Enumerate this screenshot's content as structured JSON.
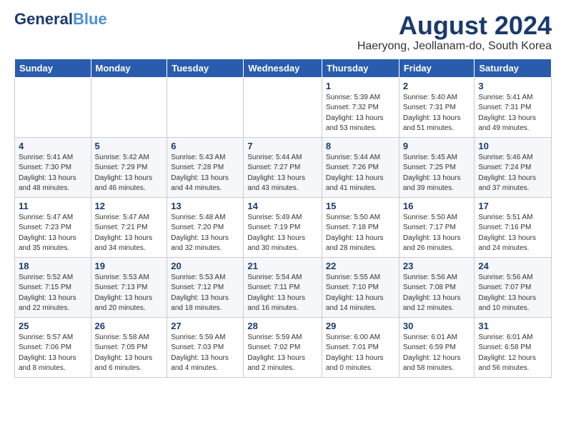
{
  "logo": {
    "line1": "General",
    "line1_accent": "Blue",
    "tagline": ""
  },
  "title": "August 2024",
  "location": "Haeryong, Jeollanam-do, South Korea",
  "weekdays": [
    "Sunday",
    "Monday",
    "Tuesday",
    "Wednesday",
    "Thursday",
    "Friday",
    "Saturday"
  ],
  "weeks": [
    [
      {
        "day": "",
        "info": ""
      },
      {
        "day": "",
        "info": ""
      },
      {
        "day": "",
        "info": ""
      },
      {
        "day": "",
        "info": ""
      },
      {
        "day": "1",
        "info": "Sunrise: 5:39 AM\nSunset: 7:32 PM\nDaylight: 13 hours\nand 53 minutes."
      },
      {
        "day": "2",
        "info": "Sunrise: 5:40 AM\nSunset: 7:31 PM\nDaylight: 13 hours\nand 51 minutes."
      },
      {
        "day": "3",
        "info": "Sunrise: 5:41 AM\nSunset: 7:31 PM\nDaylight: 13 hours\nand 49 minutes."
      }
    ],
    [
      {
        "day": "4",
        "info": "Sunrise: 5:41 AM\nSunset: 7:30 PM\nDaylight: 13 hours\nand 48 minutes."
      },
      {
        "day": "5",
        "info": "Sunrise: 5:42 AM\nSunset: 7:29 PM\nDaylight: 13 hours\nand 46 minutes."
      },
      {
        "day": "6",
        "info": "Sunrise: 5:43 AM\nSunset: 7:28 PM\nDaylight: 13 hours\nand 44 minutes."
      },
      {
        "day": "7",
        "info": "Sunrise: 5:44 AM\nSunset: 7:27 PM\nDaylight: 13 hours\nand 43 minutes."
      },
      {
        "day": "8",
        "info": "Sunrise: 5:44 AM\nSunset: 7:26 PM\nDaylight: 13 hours\nand 41 minutes."
      },
      {
        "day": "9",
        "info": "Sunrise: 5:45 AM\nSunset: 7:25 PM\nDaylight: 13 hours\nand 39 minutes."
      },
      {
        "day": "10",
        "info": "Sunrise: 5:46 AM\nSunset: 7:24 PM\nDaylight: 13 hours\nand 37 minutes."
      }
    ],
    [
      {
        "day": "11",
        "info": "Sunrise: 5:47 AM\nSunset: 7:23 PM\nDaylight: 13 hours\nand 35 minutes."
      },
      {
        "day": "12",
        "info": "Sunrise: 5:47 AM\nSunset: 7:21 PM\nDaylight: 13 hours\nand 34 minutes."
      },
      {
        "day": "13",
        "info": "Sunrise: 5:48 AM\nSunset: 7:20 PM\nDaylight: 13 hours\nand 32 minutes."
      },
      {
        "day": "14",
        "info": "Sunrise: 5:49 AM\nSunset: 7:19 PM\nDaylight: 13 hours\nand 30 minutes."
      },
      {
        "day": "15",
        "info": "Sunrise: 5:50 AM\nSunset: 7:18 PM\nDaylight: 13 hours\nand 28 minutes."
      },
      {
        "day": "16",
        "info": "Sunrise: 5:50 AM\nSunset: 7:17 PM\nDaylight: 13 hours\nand 26 minutes."
      },
      {
        "day": "17",
        "info": "Sunrise: 5:51 AM\nSunset: 7:16 PM\nDaylight: 13 hours\nand 24 minutes."
      }
    ],
    [
      {
        "day": "18",
        "info": "Sunrise: 5:52 AM\nSunset: 7:15 PM\nDaylight: 13 hours\nand 22 minutes."
      },
      {
        "day": "19",
        "info": "Sunrise: 5:53 AM\nSunset: 7:13 PM\nDaylight: 13 hours\nand 20 minutes."
      },
      {
        "day": "20",
        "info": "Sunrise: 5:53 AM\nSunset: 7:12 PM\nDaylight: 13 hours\nand 18 minutes."
      },
      {
        "day": "21",
        "info": "Sunrise: 5:54 AM\nSunset: 7:11 PM\nDaylight: 13 hours\nand 16 minutes."
      },
      {
        "day": "22",
        "info": "Sunrise: 5:55 AM\nSunset: 7:10 PM\nDaylight: 13 hours\nand 14 minutes."
      },
      {
        "day": "23",
        "info": "Sunrise: 5:56 AM\nSunset: 7:08 PM\nDaylight: 13 hours\nand 12 minutes."
      },
      {
        "day": "24",
        "info": "Sunrise: 5:56 AM\nSunset: 7:07 PM\nDaylight: 13 hours\nand 10 minutes."
      }
    ],
    [
      {
        "day": "25",
        "info": "Sunrise: 5:57 AM\nSunset: 7:06 PM\nDaylight: 13 hours\nand 8 minutes."
      },
      {
        "day": "26",
        "info": "Sunrise: 5:58 AM\nSunset: 7:05 PM\nDaylight: 13 hours\nand 6 minutes."
      },
      {
        "day": "27",
        "info": "Sunrise: 5:59 AM\nSunset: 7:03 PM\nDaylight: 13 hours\nand 4 minutes."
      },
      {
        "day": "28",
        "info": "Sunrise: 5:59 AM\nSunset: 7:02 PM\nDaylight: 13 hours\nand 2 minutes."
      },
      {
        "day": "29",
        "info": "Sunrise: 6:00 AM\nSunset: 7:01 PM\nDaylight: 13 hours\nand 0 minutes."
      },
      {
        "day": "30",
        "info": "Sunrise: 6:01 AM\nSunset: 6:59 PM\nDaylight: 12 hours\nand 58 minutes."
      },
      {
        "day": "31",
        "info": "Sunrise: 6:01 AM\nSunset: 6:58 PM\nDaylight: 12 hours\nand 56 minutes."
      }
    ]
  ]
}
